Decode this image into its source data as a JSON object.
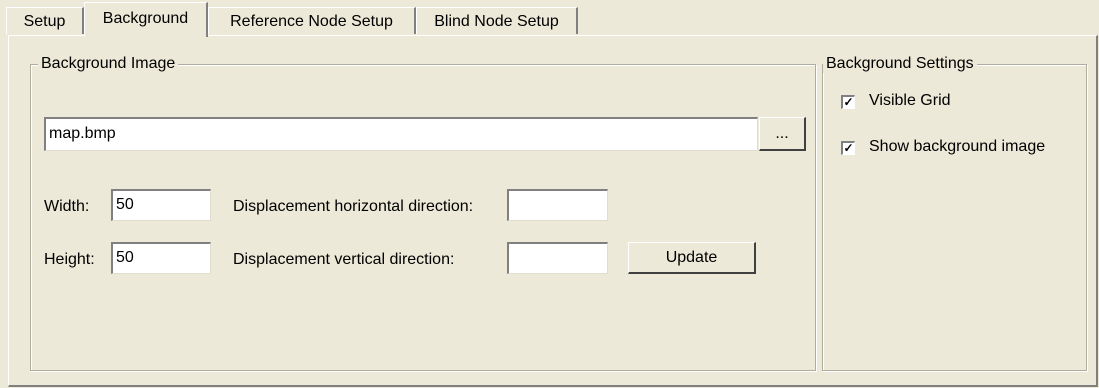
{
  "tabs": [
    {
      "label": "Setup"
    },
    {
      "label": "Background"
    },
    {
      "label": "Reference Node Setup"
    },
    {
      "label": "Blind Node Setup"
    }
  ],
  "background_image": {
    "legend": "Background Image",
    "file_value": "map.bmp",
    "browse_label": "...",
    "width_label": "Width:",
    "width_value": "50",
    "height_label": "Height:",
    "height_value": "50",
    "disp_h_label": "Displacement horizontal direction:",
    "disp_h_value": "",
    "disp_v_label": "Displacement vertical direction:",
    "disp_v_value": "",
    "update_label": "Update"
  },
  "background_settings": {
    "legend": "Background Settings",
    "visible_grid_label": "Visible Grid",
    "visible_grid_checked": true,
    "show_image_label": "Show background image",
    "show_image_checked": true,
    "check_glyph": "✓"
  }
}
